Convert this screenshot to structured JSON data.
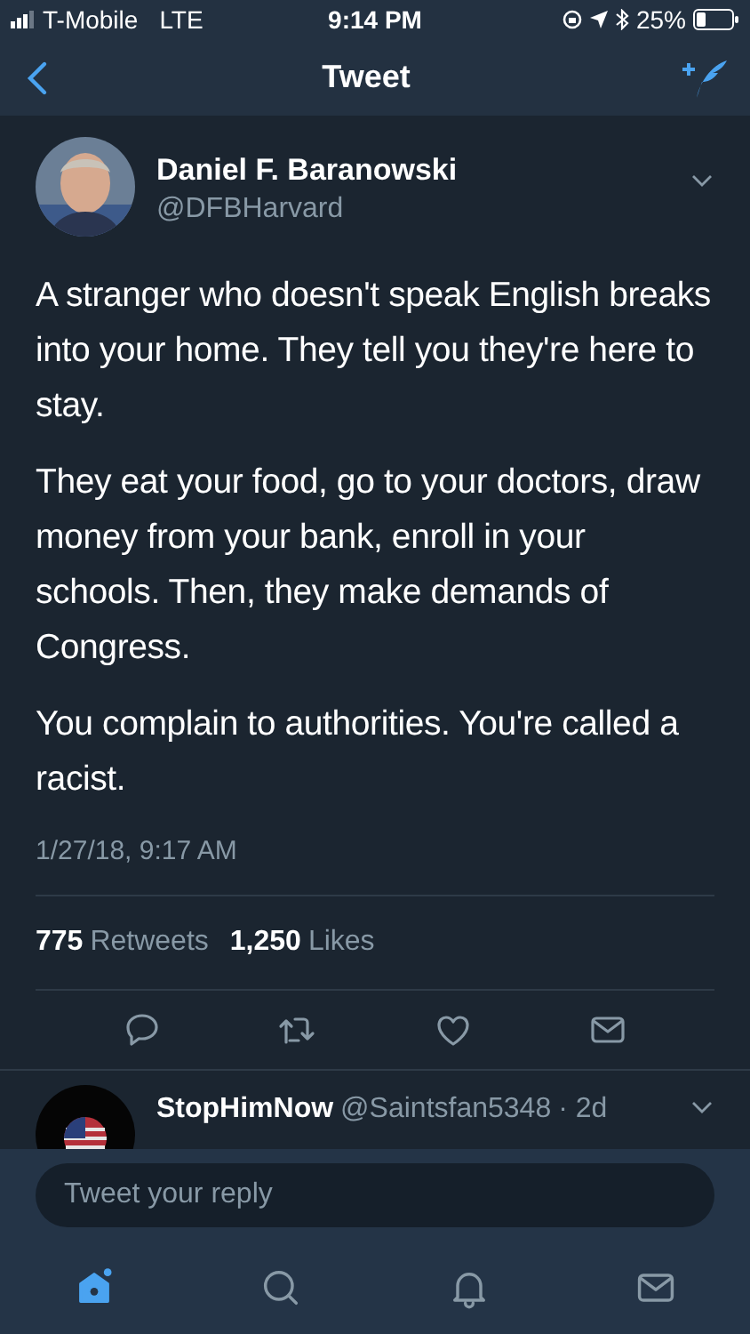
{
  "status_bar": {
    "carrier": "T-Mobile",
    "network": "LTE",
    "time": "9:14 PM",
    "battery": "25%"
  },
  "nav": {
    "title": "Tweet"
  },
  "tweet": {
    "name": "Daniel F. Baranowski",
    "handle": "@DFBHarvard",
    "paragraphs": [
      "A stranger who doesn't speak English breaks into your home. They tell you they're here to stay.",
      "They eat your food, go to your doctors, draw money from your bank, enroll in your schools. Then, they make demands of Congress.",
      "You complain to authorities. You're called a racist."
    ],
    "timestamp": "1/27/18, 9:17 AM",
    "stats": [
      {
        "count": "775",
        "label": "Retweets"
      },
      {
        "count": "1,250",
        "label": "Likes"
      }
    ],
    "actions": [
      {
        "kind": "reply"
      },
      {
        "kind": "retweet"
      },
      {
        "kind": "like"
      },
      {
        "kind": "message"
      }
    ]
  },
  "reply": {
    "name": "StopHimNow",
    "handle": "@Saintsfan5348",
    "age": "· 2d"
  },
  "composer": {
    "placeholder": "Tweet your reply"
  },
  "tabs": [
    {
      "kind": "home",
      "selected": true
    },
    {
      "kind": "search",
      "selected": false
    },
    {
      "kind": "notifications",
      "selected": false
    },
    {
      "kind": "messages",
      "selected": false
    }
  ]
}
